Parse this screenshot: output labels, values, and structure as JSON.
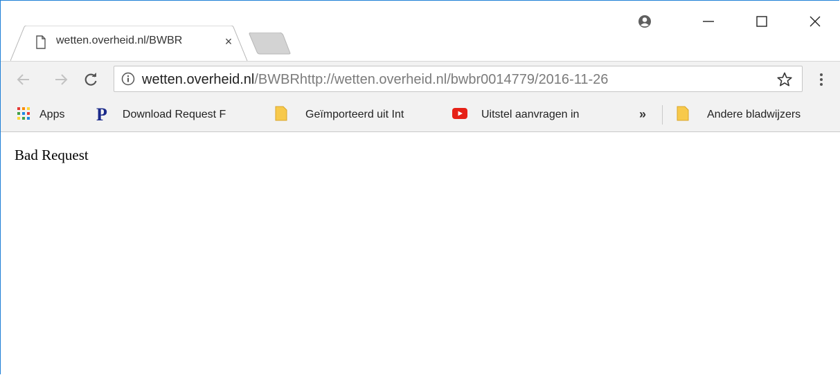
{
  "tab": {
    "title": "wetten.overheid.nl/BWBR",
    "close_label": "×",
    "icon": "page-icon"
  },
  "window_controls": {
    "account_icon": "account-icon",
    "minimize_icon": "minimize-icon",
    "maximize_icon": "maximize-icon",
    "close_icon": "close-icon"
  },
  "toolbar": {
    "url_host": "wetten.overheid.nl",
    "url_rest": "/BWBRhttp://wetten.overheid.nl/bwbr0014779/2016-11-26"
  },
  "bookmarks": {
    "items": [
      {
        "label": "Apps",
        "icon": "apps-grid-icon"
      },
      {
        "label": "Download Request F",
        "icon": "p-logo-icon"
      },
      {
        "label": "Geïmporteerd uit Int",
        "icon": "folder-icon"
      },
      {
        "label": "Uitstel aanvragen in",
        "icon": "youtube-icon"
      }
    ],
    "overflow_label": "»",
    "other_label": "Andere bladwijzers"
  },
  "page": {
    "body_text": "Bad Request"
  },
  "colors": {
    "window_border": "#1e7fd6",
    "toolbar_bg": "#f2f2f2",
    "youtube_red": "#e62117",
    "folder_yellow": "#f7c94b",
    "p_logo_blue": "#1b2a8a"
  }
}
